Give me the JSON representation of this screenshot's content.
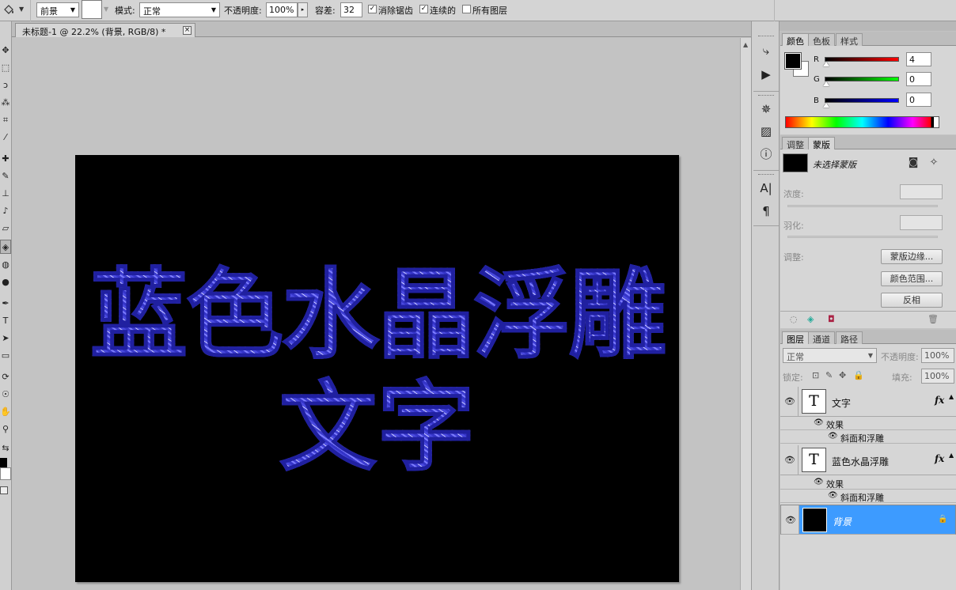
{
  "options_bar": {
    "fill_source": "前景",
    "mode_label": "模式:",
    "mode_value": "正常",
    "opacity_label": "不透明度:",
    "opacity_value": "100%",
    "tolerance_label": "容差:",
    "tolerance_value": "32",
    "anti_alias_label": "消除锯齿",
    "anti_alias_checked": true,
    "contiguous_label": "连续的",
    "contiguous_checked": true,
    "all_layers_label": "所有图层",
    "all_layers_checked": false
  },
  "document": {
    "tab_title": "未标题-1 @ 22.2% (背景, RGB/8) *",
    "close_glyph": "×",
    "text_line1": "蓝色水晶浮雕",
    "text_line2": "文字",
    "text_color": "#4b4bdc"
  },
  "dock": {
    "icons": [
      "history-icon",
      "actions-icon",
      "navigator-icon",
      "histogram-icon",
      "info-icon",
      "character-icon",
      "paragraph-icon"
    ],
    "collapse_glyph": "◂◂"
  },
  "color_panel": {
    "tabs": [
      "颜色",
      "色板",
      "样式"
    ],
    "active_tab": 0,
    "channels": [
      {
        "label": "R",
        "value": "4"
      },
      {
        "label": "G",
        "value": "0"
      },
      {
        "label": "B",
        "value": "0"
      }
    ],
    "foreground": "#000000",
    "background": "#ffffff"
  },
  "masks_panel": {
    "tabs": [
      "调整",
      "蒙版"
    ],
    "active_tab": 1,
    "title": "未选择蒙版",
    "density_label": "浓度:",
    "feather_label": "羽化:",
    "refine_label": "调整:",
    "mask_edge_button": "蒙版边缘...",
    "color_range_button": "颜色范围...",
    "invert_button": "反相"
  },
  "layers_panel": {
    "tabs": [
      "图层",
      "通道",
      "路径"
    ],
    "active_tab": 0,
    "blend_mode": "正常",
    "opacity_label": "不透明度:",
    "opacity_value": "100%",
    "lock_label": "锁定:",
    "fill_label": "填充:",
    "fill_value": "100%",
    "layers": [
      {
        "name": "文字",
        "type": "text",
        "fx": "fx",
        "effects_label": "效果",
        "effect": "斜面和浮雕"
      },
      {
        "name": "蓝色水晶浮雕",
        "type": "text",
        "fx": "fx",
        "effects_label": "效果",
        "effect": "斜面和浮雕"
      },
      {
        "name": "背景",
        "type": "background",
        "selected": true
      }
    ],
    "selected_color": "#3d9bff"
  }
}
